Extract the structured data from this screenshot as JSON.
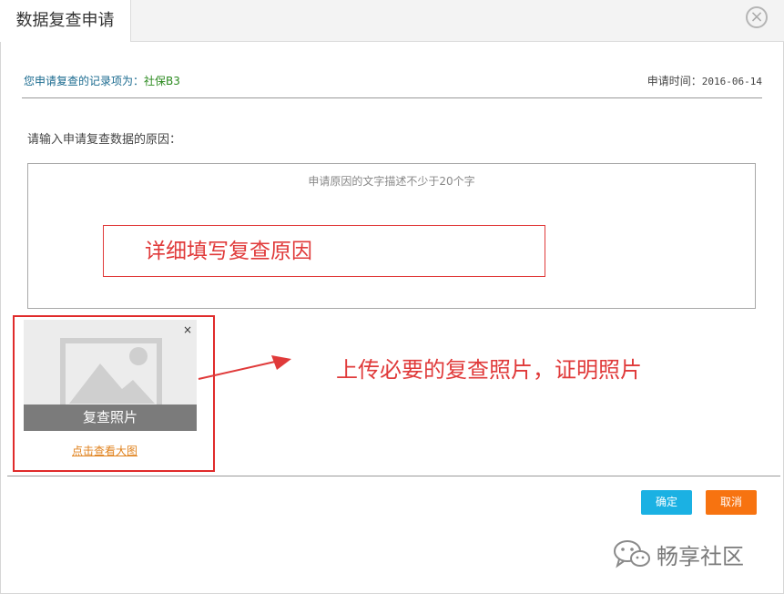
{
  "dialog": {
    "title": "数据复查申请",
    "close_glyph": "×"
  },
  "record": {
    "label": "您申请复查的记录项为：",
    "value": "社保B3"
  },
  "apply_date": {
    "label": "申请时间：",
    "value": "2016-06-14"
  },
  "reason": {
    "label": "请输入申请复查数据的原因：",
    "placeholder": "申请原因的文字描述不少于20个字"
  },
  "annotations": {
    "reason_note": "详细填写复查原因",
    "photo_note": "上传必要的复查照片，证明照片"
  },
  "photo": {
    "caption": "复查照片",
    "remove_glyph": "×",
    "view_link": "点击查看大图"
  },
  "buttons": {
    "confirm": "确定",
    "cancel": "取消"
  },
  "watermark": {
    "text": "畅享社区"
  },
  "colors": {
    "confirm": "#1bb1e3",
    "cancel": "#f77310",
    "annotation": "#e03a3a",
    "link": "#e0821d"
  }
}
